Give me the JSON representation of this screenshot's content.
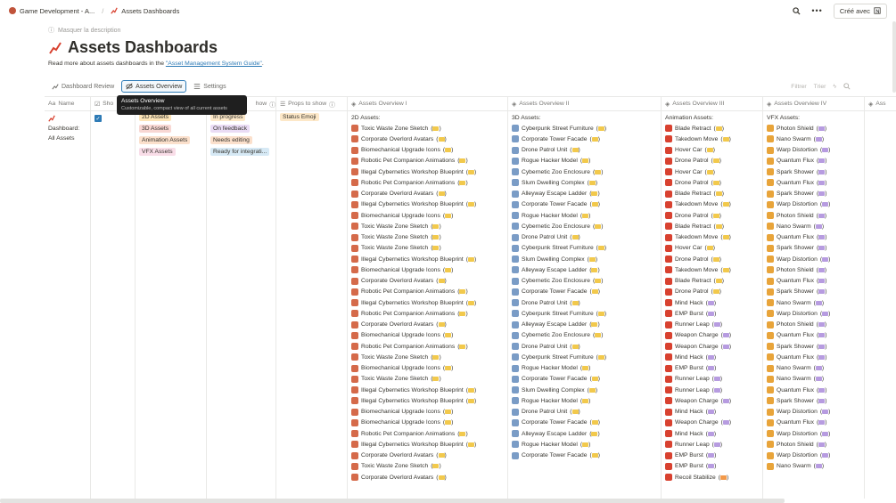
{
  "breadcrumb": {
    "workspace": "Game Development - A...",
    "page": "Assets Dashboards"
  },
  "topbar": {
    "share_label": "Créé avec"
  },
  "hide_description": "Masquer la description",
  "page_title": "Assets Dashboards",
  "description": {
    "prefix": "Read more about assets dashboards in the ",
    "link": "\"Asset Management System Guide\"",
    "suffix": "."
  },
  "views": {
    "tabs": [
      "Dashboard Review",
      "Assets Overview",
      "Settings"
    ],
    "active": "Assets Overview"
  },
  "tools": {
    "filter": "Filtrer",
    "sort": "Trier"
  },
  "tooltip": {
    "title": "Assets Overview",
    "subtitle": "Customizable, compact view of all current assets"
  },
  "columns": {
    "name": "Name",
    "show": "Sho",
    "status_show": "how",
    "props": "Props to show",
    "ov1": "Assets Overview I",
    "ov2": "Assets Overview II",
    "ov3": "Assets Overview III",
    "ov4": "Assets Overview IV",
    "ov5": "Ass"
  },
  "row": {
    "name": "Dashboard: All Assets",
    "types": [
      "2D Assets",
      "3D Assets",
      "Animation Assets",
      "VFX Assets"
    ],
    "statuses": [
      "In progress",
      "On feedback",
      "Needs editing",
      "Ready for integrati..."
    ],
    "prop": "Status Emoji"
  },
  "ov_heads": {
    "ov1": "2D Assets:",
    "ov2": "3D Assets:",
    "ov3": "Animation Assets:",
    "ov4": "VFX Assets:"
  },
  "colors": {
    "yellow": "#f2c94c",
    "purple": "#b79ce0",
    "orange": "#f2994a",
    "accent": "#2e7bb6"
  },
  "lists": {
    "ov1": [
      "Toxic Waste Zone Sketch",
      "Corporate Overlord Avatars",
      "Biomechanical Upgrade Icons",
      "Robotic Pet Companion Animations",
      "Illegal Cybernetics Workshop Blueprint",
      "Robotic Pet Companion Animations",
      "Corporate Overlord Avatars",
      "Illegal Cybernetics Workshop Blueprint",
      "Biomechanical Upgrade Icons",
      "Toxic Waste Zone Sketch",
      "Toxic Waste Zone Sketch",
      "Toxic Waste Zone Sketch",
      "Illegal Cybernetics Workshop Blueprint",
      "Biomechanical Upgrade Icons",
      "Corporate Overlord Avatars",
      "Robotic Pet Companion Animations",
      "Illegal Cybernetics Workshop Blueprint",
      "Robotic Pet Companion Animations",
      "Corporate Overlord Avatars",
      "Biomechanical Upgrade Icons",
      "Robotic Pet Companion Animations",
      "Toxic Waste Zone Sketch",
      "Biomechanical Upgrade Icons",
      "Toxic Waste Zone Sketch",
      "Illegal Cybernetics Workshop Blueprint",
      "Illegal Cybernetics Workshop Blueprint",
      "Biomechanical Upgrade Icons",
      "Biomechanical Upgrade Icons",
      "Robotic Pet Companion Animations",
      "Illegal Cybernetics Workshop Blueprint",
      "Corporate Overlord Avatars",
      "Toxic Waste Zone Sketch",
      "Corporate Overlord Avatars"
    ],
    "ov2": [
      "Cyberpunk Street Furniture",
      "Corporate Tower Facade",
      "Drone Patrol Unit",
      "Rogue Hacker Model",
      "Cybernetic Zoo Enclosure",
      "Slum Dwelling Complex",
      "Alleyway Escape Ladder",
      "Corporate Tower Facade",
      "Rogue Hacker Model",
      "Cybernetic Zoo Enclosure",
      "Drone Patrol Unit",
      "Cyberpunk Street Furniture",
      "Slum Dwelling Complex",
      "Alleyway Escape Ladder",
      "Cybernetic Zoo Enclosure",
      "Corporate Tower Facade",
      "Drone Patrol Unit",
      "Cyberpunk Street Furniture",
      "Alleyway Escape Ladder",
      "Cybernetic Zoo Enclosure",
      "Drone Patrol Unit",
      "Cyberpunk Street Furniture",
      "Rogue Hacker Model",
      "Corporate Tower Facade",
      "Slum Dwelling Complex",
      "Rogue Hacker Model",
      "Drone Patrol Unit",
      "Corporate Tower Facade",
      "Alleyway Escape Ladder",
      "Rogue Hacker Model",
      "Corporate Tower Facade"
    ],
    "ov3": [
      {
        "t": "Blade Retract",
        "c": "yellow"
      },
      {
        "t": "Takedown Move",
        "c": "yellow"
      },
      {
        "t": "Hover Car",
        "c": "yellow"
      },
      {
        "t": "Drone Patrol",
        "c": "yellow"
      },
      {
        "t": "Hover Car",
        "c": "yellow"
      },
      {
        "t": "Drone Patrol",
        "c": "yellow"
      },
      {
        "t": "Blade Retract",
        "c": "yellow"
      },
      {
        "t": "Takedown Move",
        "c": "yellow"
      },
      {
        "t": "Drone Patrol",
        "c": "yellow"
      },
      {
        "t": "Blade Retract",
        "c": "yellow"
      },
      {
        "t": "Takedown Move",
        "c": "yellow"
      },
      {
        "t": "Hover Car",
        "c": "yellow"
      },
      {
        "t": "Drone Patrol",
        "c": "yellow"
      },
      {
        "t": "Takedown Move",
        "c": "yellow"
      },
      {
        "t": "Blade Retract",
        "c": "yellow"
      },
      {
        "t": "Drone Patrol",
        "c": "yellow"
      },
      {
        "t": "Mind Hack",
        "c": "purple"
      },
      {
        "t": "EMP Burst",
        "c": "purple"
      },
      {
        "t": "Runner Leap",
        "c": "purple"
      },
      {
        "t": "Weapon Charge",
        "c": "purple"
      },
      {
        "t": "Weapon Charge",
        "c": "purple"
      },
      {
        "t": "Mind Hack",
        "c": "purple"
      },
      {
        "t": "EMP Burst",
        "c": "purple"
      },
      {
        "t": "Runner Leap",
        "c": "purple"
      },
      {
        "t": "Runner Leap",
        "c": "purple"
      },
      {
        "t": "Weapon Charge",
        "c": "purple"
      },
      {
        "t": "Mind Hack",
        "c": "purple"
      },
      {
        "t": "Weapon Charge",
        "c": "purple"
      },
      {
        "t": "Mind Hack",
        "c": "purple"
      },
      {
        "t": "Runner Leap",
        "c": "purple"
      },
      {
        "t": "EMP Burst",
        "c": "purple"
      },
      {
        "t": "EMP Burst",
        "c": "purple"
      },
      {
        "t": "Recoil Stabilize",
        "c": "orange"
      }
    ],
    "ov4": [
      "Photon Shield",
      "Nano Swarm",
      "Warp Distortion",
      "Quantum Flux",
      "Spark Shower",
      "Quantum Flux",
      "Spark Shower",
      "Warp Distortion",
      "Photon Shield",
      "Nano Swarm",
      "Quantum Flux",
      "Spark Shower",
      "Warp Distortion",
      "Photon Shield",
      "Quantum Flux",
      "Spark Shower",
      "Nano Swarm",
      "Warp Distortion",
      "Photon Shield",
      "Quantum Flux",
      "Spark Shower",
      "Quantum Flux",
      "Nano Swarm",
      "Nano Swarm",
      "Quantum Flux",
      "Spark Shower",
      "Warp Distortion",
      "Quantum Flux",
      "Warp Distortion",
      "Photon Shield",
      "Warp Distortion",
      "Nano Swarm"
    ]
  }
}
